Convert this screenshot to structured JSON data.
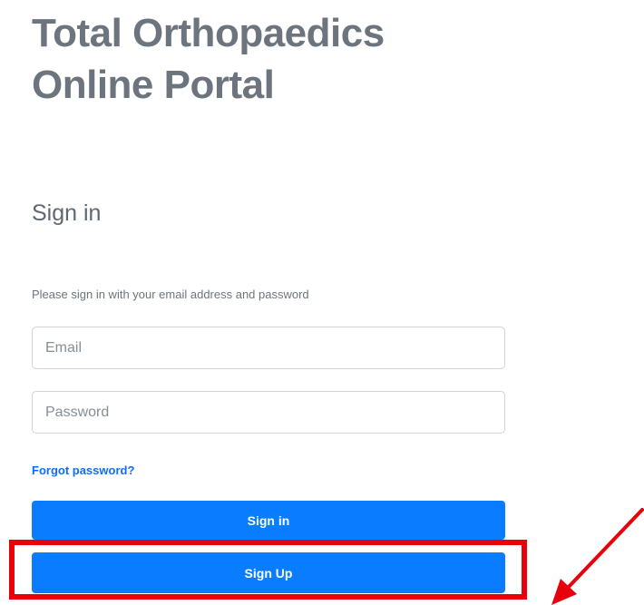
{
  "header": {
    "title_line1": "Total Orthopaedics",
    "title_line2": "Online Portal"
  },
  "signin": {
    "heading": "Sign in",
    "instructions": "Please sign in with your email address and password",
    "email_placeholder": "Email",
    "password_placeholder": "Password",
    "forgot_label": "Forgot password?",
    "signin_button": "Sign in",
    "signup_button": "Sign Up"
  },
  "annotation": {
    "highlight_color": "#e8000b",
    "target": "signup-button",
    "arrow_icon": "arrow-pointing-left-icon"
  },
  "colors": {
    "primary_button": "#0a7cff",
    "link": "#0d6efd",
    "title": "#6c757d"
  }
}
